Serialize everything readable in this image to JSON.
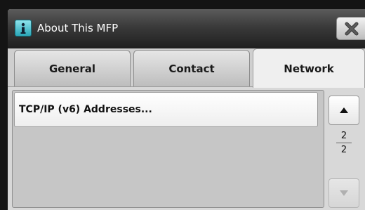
{
  "window": {
    "title": "About This MFP",
    "title_icon": "info-icon",
    "close_icon": "close-icon"
  },
  "tabs": [
    {
      "label": "General",
      "selected": false
    },
    {
      "label": "Contact",
      "selected": false
    },
    {
      "label": "Network",
      "selected": true
    }
  ],
  "list": {
    "items": [
      {
        "label": "TCP/IP (v6) Addresses..."
      }
    ]
  },
  "pager": {
    "current": "2",
    "total": "2",
    "up_icon": "triangle-up-icon",
    "down_icon": "triangle-down-icon"
  },
  "colors": {
    "titlebar": "#2f2f2f",
    "title_icon_bg": "#2aa7b8",
    "background": "#d6d6d6"
  }
}
